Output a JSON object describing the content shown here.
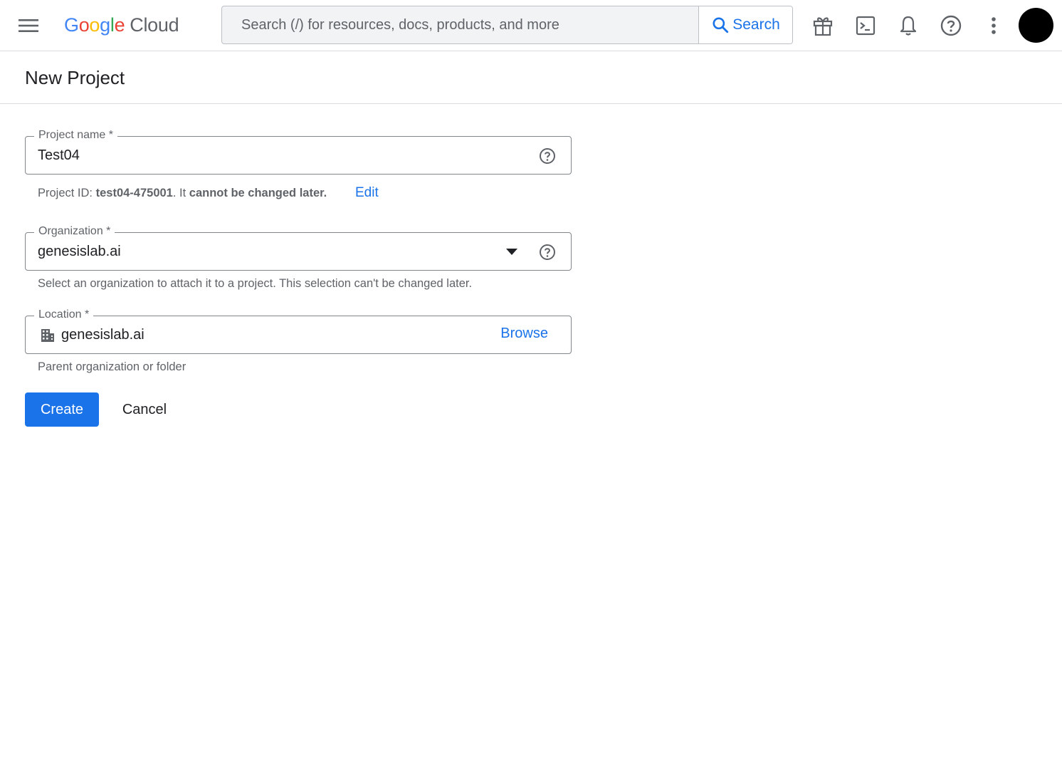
{
  "header": {
    "logo_google": "Google",
    "logo_cloud": "Cloud",
    "search_placeholder": "Search (/) for resources, docs, products, and more",
    "search_button": "Search",
    "icons": [
      "menu-icon",
      "gift-icon",
      "terminal-icon",
      "bell-icon",
      "help-icon",
      "more-vert-icon"
    ]
  },
  "page": {
    "title": "New Project"
  },
  "form": {
    "project_name": {
      "label": "Project name *",
      "value": "Test04"
    },
    "project_id_hint": {
      "prefix": "Project ID: ",
      "id": "test04-475001",
      "middle": ". It ",
      "suffix": "cannot be changed later.",
      "edit_label": "Edit"
    },
    "organization": {
      "label": "Organization *",
      "value": "genesislab.ai",
      "hint": "Select an organization to attach it to a project. This selection can't be changed later."
    },
    "location": {
      "label": "Location *",
      "value": "genesislab.ai",
      "browse_label": "Browse",
      "hint": "Parent organization or folder"
    },
    "create_label": "Create",
    "cancel_label": "Cancel"
  },
  "colors": {
    "accent": "#1a73e8",
    "border": "#80868b",
    "muted_text": "#5f6368"
  }
}
